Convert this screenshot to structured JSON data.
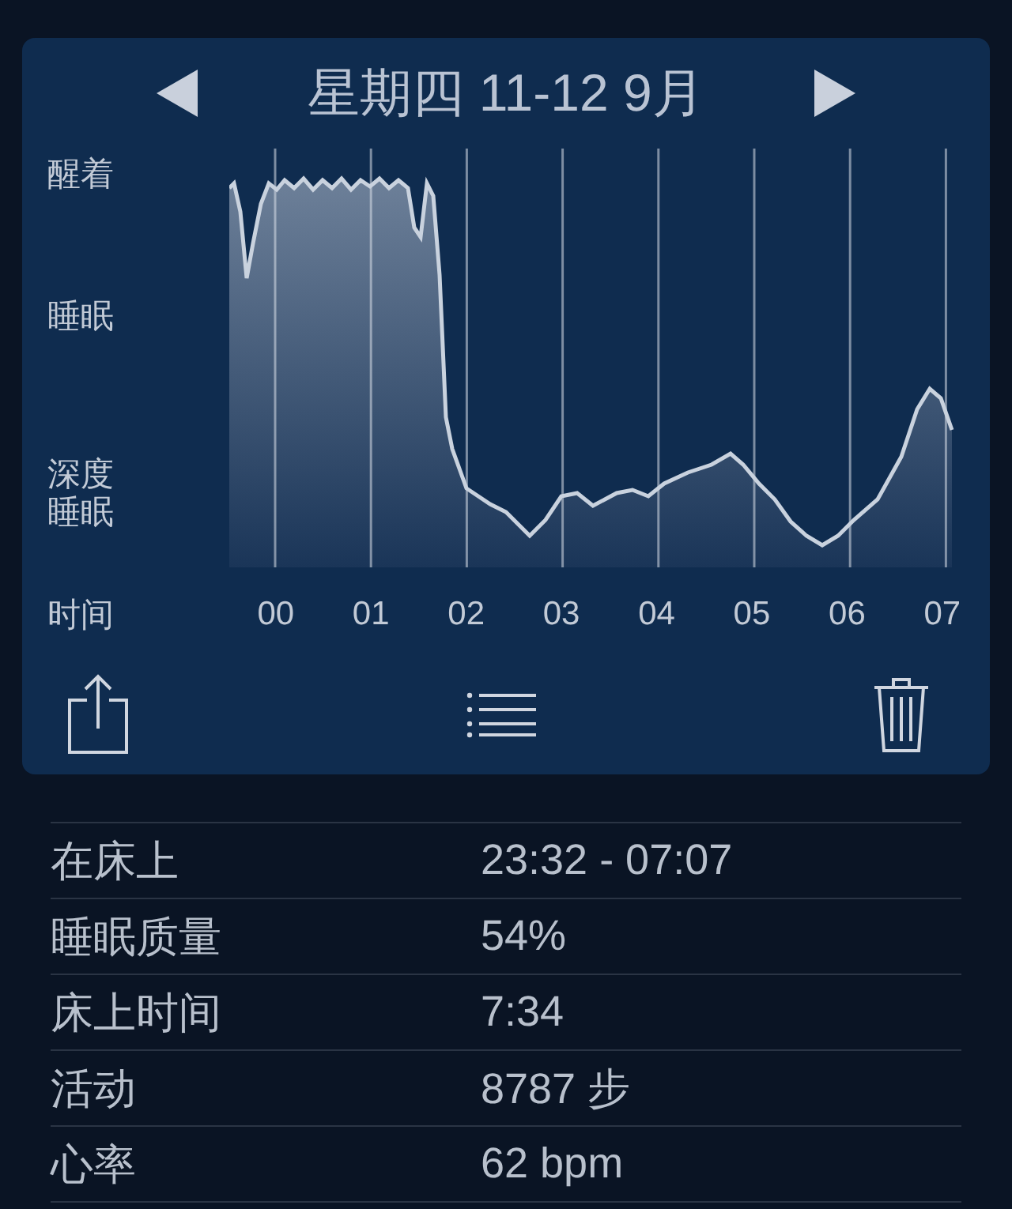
{
  "header": {
    "title": "星期四 11-12 9月"
  },
  "graph": {
    "y_labels": [
      "醒着",
      "睡眠",
      "深度睡眠"
    ],
    "x_label": "时间",
    "x_ticks": [
      "00",
      "01",
      "02",
      "03",
      "04",
      "05",
      "06",
      "07"
    ]
  },
  "stats": [
    {
      "label": "在床上",
      "value": "23:32 - 07:07"
    },
    {
      "label": "睡眠质量",
      "value": "54%"
    },
    {
      "label": "床上时间",
      "value": "7:34"
    },
    {
      "label": "活动",
      "value": "8787 步"
    },
    {
      "label": "心率",
      "value": "62 bpm"
    }
  ]
}
